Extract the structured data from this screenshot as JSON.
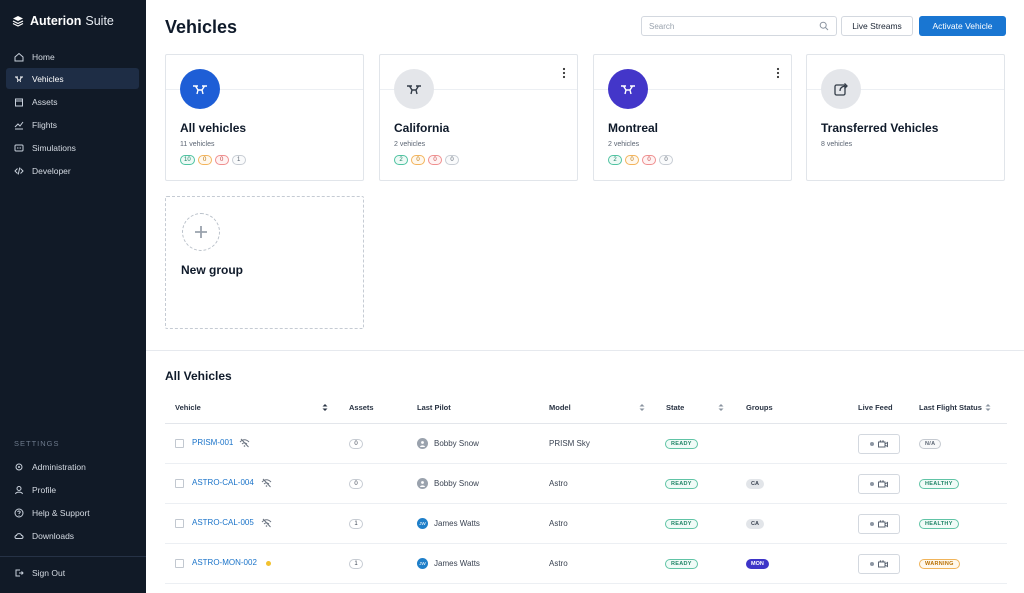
{
  "brand": {
    "name": "Auterion",
    "suffix": "Suite"
  },
  "sidebar": {
    "items": [
      {
        "label": "Home",
        "icon": "home-icon"
      },
      {
        "label": "Vehicles",
        "icon": "drone-icon",
        "active": true
      },
      {
        "label": "Assets",
        "icon": "box-icon"
      },
      {
        "label": "Flights",
        "icon": "chart-icon"
      },
      {
        "label": "Simulations",
        "icon": "sim-icon"
      },
      {
        "label": "Developer",
        "icon": "code-icon"
      }
    ],
    "settings_label": "SETTINGS",
    "settings_items": [
      {
        "label": "Administration",
        "icon": "gear-icon"
      },
      {
        "label": "Profile",
        "icon": "user-icon"
      },
      {
        "label": "Help & Support",
        "icon": "help-icon"
      },
      {
        "label": "Downloads",
        "icon": "cloud-download-icon"
      }
    ],
    "sign_out": "Sign Out"
  },
  "header": {
    "title": "Vehicles",
    "search_placeholder": "Search",
    "live_streams": "Live Streams",
    "activate_vehicle": "Activate Vehicle"
  },
  "groups": [
    {
      "name": "All vehicles",
      "count": "11 vehicles",
      "pills": [
        "10",
        "0",
        "0",
        "1"
      ],
      "color": "#1e5ed6"
    },
    {
      "name": "California",
      "count": "2 vehicles",
      "pills": [
        "2",
        "0",
        "0",
        "0"
      ],
      "color": "#e4e6ea"
    },
    {
      "name": "Montreal",
      "count": "2 vehicles",
      "pills": [
        "2",
        "0",
        "0",
        "0"
      ],
      "color": "#4336c9"
    },
    {
      "name": "Transferred Vehicles",
      "count": "8 vehicles",
      "color": "#e4e6ea"
    }
  ],
  "new_group": {
    "label": "New group"
  },
  "table": {
    "title": "All Vehicles",
    "columns": [
      "Vehicle",
      "Assets",
      "Last Pilot",
      "Model",
      "State",
      "Groups",
      "Live Feed",
      "Last Flight Status"
    ],
    "rows": [
      {
        "vehicle": "PRISM-001",
        "conn": "offline",
        "assets": "0",
        "pilot": "Bobby Snow",
        "pilot_initials": "",
        "model": "PRISM Sky",
        "state": "READY",
        "group": "",
        "status": "N/A"
      },
      {
        "vehicle": "ASTRO-CAL-004",
        "conn": "offline",
        "assets": "0",
        "pilot": "Bobby Snow",
        "pilot_initials": "",
        "model": "Astro",
        "state": "READY",
        "group": "CA",
        "status": "HEALTHY"
      },
      {
        "vehicle": "ASTRO-CAL-005",
        "conn": "offline",
        "assets": "1",
        "pilot": "James Watts",
        "pilot_initials": "JW",
        "model": "Astro",
        "state": "READY",
        "group": "CA",
        "status": "HEALTHY"
      },
      {
        "vehicle": "ASTRO-MON-002",
        "conn": "online",
        "assets": "1",
        "pilot": "James Watts",
        "pilot_initials": "JW",
        "model": "Astro",
        "state": "READY",
        "group": "MON",
        "status": "WARNING"
      }
    ]
  }
}
